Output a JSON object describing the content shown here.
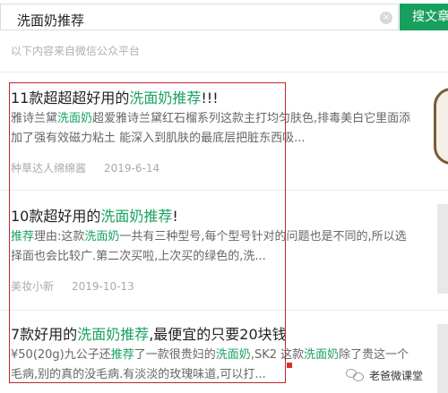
{
  "search": {
    "query": "洗面奶推荐",
    "button_label": "搜文章",
    "clear_glyph": "×"
  },
  "source_note": "以下内容来自微信公众平台",
  "articles": [
    {
      "title_pre": "11款超超超好用的",
      "title_hl": "洗面奶推荐",
      "title_post": "!!!",
      "snippet_l1_pre": "雅诗兰黛",
      "snippet_l1_hl": "洗面奶",
      "snippet_l1_post": "超爱雅诗兰黛红石榴系列这款主打均匀肤色,排毒美白它里面添",
      "snippet_l2": "加了强有效磁力粘土 能深入到肌肤的最底层把脏东西吸...",
      "author": "种草达人绵绵酱",
      "date": "2019-6-14"
    },
    {
      "title_pre": "10款超好用的",
      "title_hl": "洗面奶推荐",
      "title_post": "!",
      "snippet_l1_hl1": "推荐",
      "snippet_l1_mid": "理由:这款",
      "snippet_l1_hl2": "洗面奶",
      "snippet_l1_post": "一共有三种型号,每个型号针对的问题也是不同的,所以选",
      "snippet_l2": "择面也会比较广.第二次买啦,上次买的绿色的,洗...",
      "author": "美妆小新",
      "date": "2019-10-13"
    },
    {
      "title_pre": "7款好用的",
      "title_hl": "洗面奶推荐",
      "title_post": ",最便宜的只要20块钱",
      "snippet_l1_a": "¥50(20g)九公子还",
      "snippet_l1_hl1": "推荐",
      "snippet_l1_b": "了一款很贵妇的",
      "snippet_l1_hl2": "洗面奶",
      "snippet_l1_c": ",SK2 这款",
      "snippet_l1_hl3": "洗面奶",
      "snippet_l1_d": "除了贵这一个",
      "snippet_l2": "毛病,别的真的没毛病.有淡淡的玫瑰味道,可以打..."
    }
  ],
  "watermark": "老爸微课堂",
  "icons": {
    "clear": "clear-icon",
    "watermark": "wechat-icon"
  },
  "colors": {
    "accent": "#1aa260",
    "button": "#17a05d",
    "frame": "#c0262d"
  }
}
